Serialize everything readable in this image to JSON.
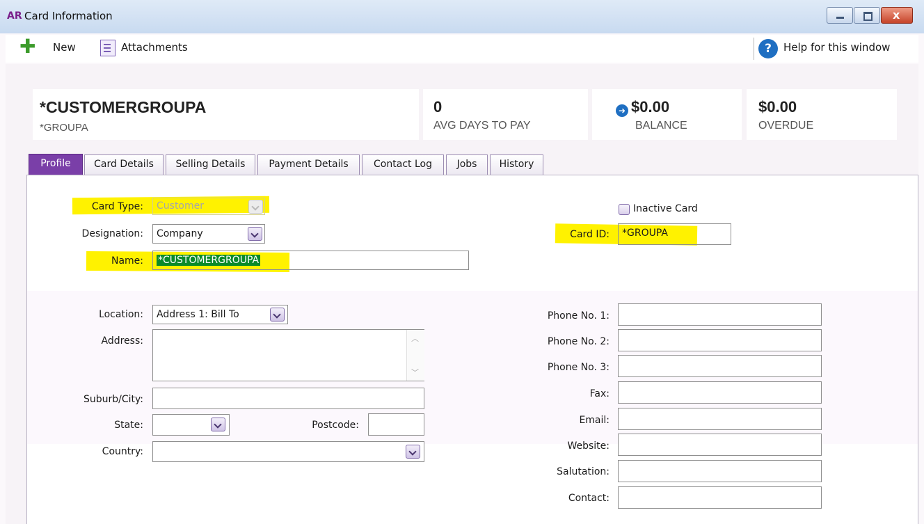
{
  "window": {
    "badge": "AR",
    "title": "Card Information",
    "close_glyph": "x"
  },
  "toolbar": {
    "new_label": "New",
    "attachments_label": "Attachments",
    "help_label": "Help for this window",
    "help_glyph": "?"
  },
  "summary": {
    "card_name": "*CUSTOMERGROUPA",
    "card_id": "*GROUPA",
    "avg_days_value": "0",
    "avg_days_label": "AVG DAYS TO PAY",
    "balance_value": "$0.00",
    "balance_label": "BALANCE",
    "overdue_value": "$0.00",
    "overdue_label": "OVERDUE"
  },
  "tabs": [
    {
      "label": "Profile",
      "active": true
    },
    {
      "label": "Card Details"
    },
    {
      "label": "Selling Details"
    },
    {
      "label": "Payment Details"
    },
    {
      "label": "Contact Log"
    },
    {
      "label": "Jobs"
    },
    {
      "label": "History"
    }
  ],
  "profile": {
    "card_type_label": "Card Type:",
    "card_type_value": "Customer",
    "designation_label": "Designation:",
    "designation_value": "Company",
    "name_label": "Name:",
    "name_value": "*CUSTOMERGROUPA",
    "inactive_label": "Inactive Card",
    "inactive_checked": false,
    "card_id_label": "Card ID:",
    "card_id_value": "*GROUPA",
    "location_label": "Location:",
    "location_value": "Address 1: Bill To",
    "address_label": "Address:",
    "address_value": "",
    "suburb_label": "Suburb/City:",
    "suburb_value": "",
    "state_label": "State:",
    "state_value": "",
    "postcode_label": "Postcode:",
    "postcode_value": "",
    "country_label": "Country:",
    "country_value": "",
    "phone1_label": "Phone No. 1:",
    "phone2_label": "Phone No. 2:",
    "phone3_label": "Phone No. 3:",
    "fax_label": "Fax:",
    "email_label": "Email:",
    "website_label": "Website:",
    "salutation_label": "Salutation:",
    "contact_label": "Contact:"
  },
  "colors": {
    "highlight": "#fff200",
    "tab_active": "#7a3fa8",
    "selection": "#0a8a2a",
    "help_blue": "#1f6fc2"
  },
  "icons": [
    "new-plus-icon",
    "attachments-icon",
    "help-icon",
    "balance-arrow-icon",
    "dropdown-arrow-icon",
    "checkbox-icon"
  ]
}
